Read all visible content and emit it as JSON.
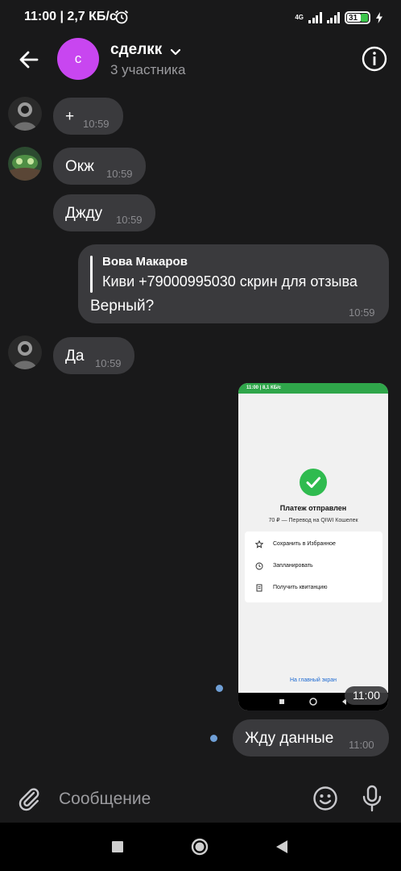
{
  "status_bar": {
    "time": "11:00",
    "speed": "2,7 КБ/с",
    "network": "4G",
    "battery": "31"
  },
  "header": {
    "avatar_letter": "с",
    "title": "сделкк",
    "subtitle": "3 участника"
  },
  "messages": [
    {
      "text": "+",
      "time": "10:59",
      "sender": "user1"
    },
    {
      "text": "Окж",
      "time": "10:59",
      "sender": "user2"
    },
    {
      "text": "Джду",
      "time": "10:59",
      "sender": "user2"
    },
    {
      "outgoing": true,
      "reply_author": "Вова Макаров",
      "reply_text": "Киви +79000995030 скрин для отзыва",
      "text": "Верный?",
      "time": "10:59"
    },
    {
      "text": "Да",
      "time": "10:59",
      "sender": "user1"
    },
    {
      "outgoing": true,
      "type": "image",
      "time": "11:00",
      "screenshot": {
        "status_time": "11:00 | 8,1 КБ/с",
        "title": "Платеж отправлен",
        "subtitle": "70 ₽ — Перевод на QIWI Кошелек",
        "options": [
          "Сохранить в Избранное",
          "Запланировать",
          "Получить квитанцию"
        ],
        "link": "На главный экран"
      }
    },
    {
      "outgoing": true,
      "text": "Жду данные",
      "time": "11:00"
    }
  ],
  "composer": {
    "placeholder": "Сообщение"
  },
  "colors": {
    "background": "#19191a",
    "bubble": "#3a3a3d",
    "avatar": "#c846f0",
    "unread_dot": "#6f9fd6"
  }
}
